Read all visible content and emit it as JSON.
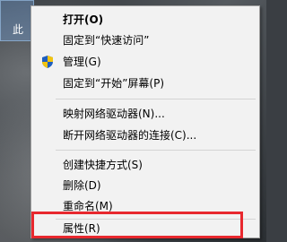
{
  "desktop": {
    "icon_label": "此"
  },
  "context_menu": {
    "items": [
      {
        "label": "打开(O)",
        "bold": true
      },
      {
        "label": "固定到“快速访问”"
      },
      {
        "label": "管理(G)",
        "icon": "uac-shield-icon"
      },
      {
        "label": "固定到“开始”屏幕(P)"
      },
      {
        "label": "映射网络驱动器(N)..."
      },
      {
        "label": "断开网络驱动器的连接(C)..."
      },
      {
        "label": "创建快捷方式(S)"
      },
      {
        "label": "删除(D)"
      },
      {
        "label": "重命名(M)"
      },
      {
        "label": "属性(R)",
        "highlighted": true
      }
    ]
  },
  "colors": {
    "menu_bg": "#f2f2f2",
    "highlight_border": "#e8282e",
    "shield_blue": "#1f5fbf",
    "shield_yellow": "#f2c40f"
  }
}
